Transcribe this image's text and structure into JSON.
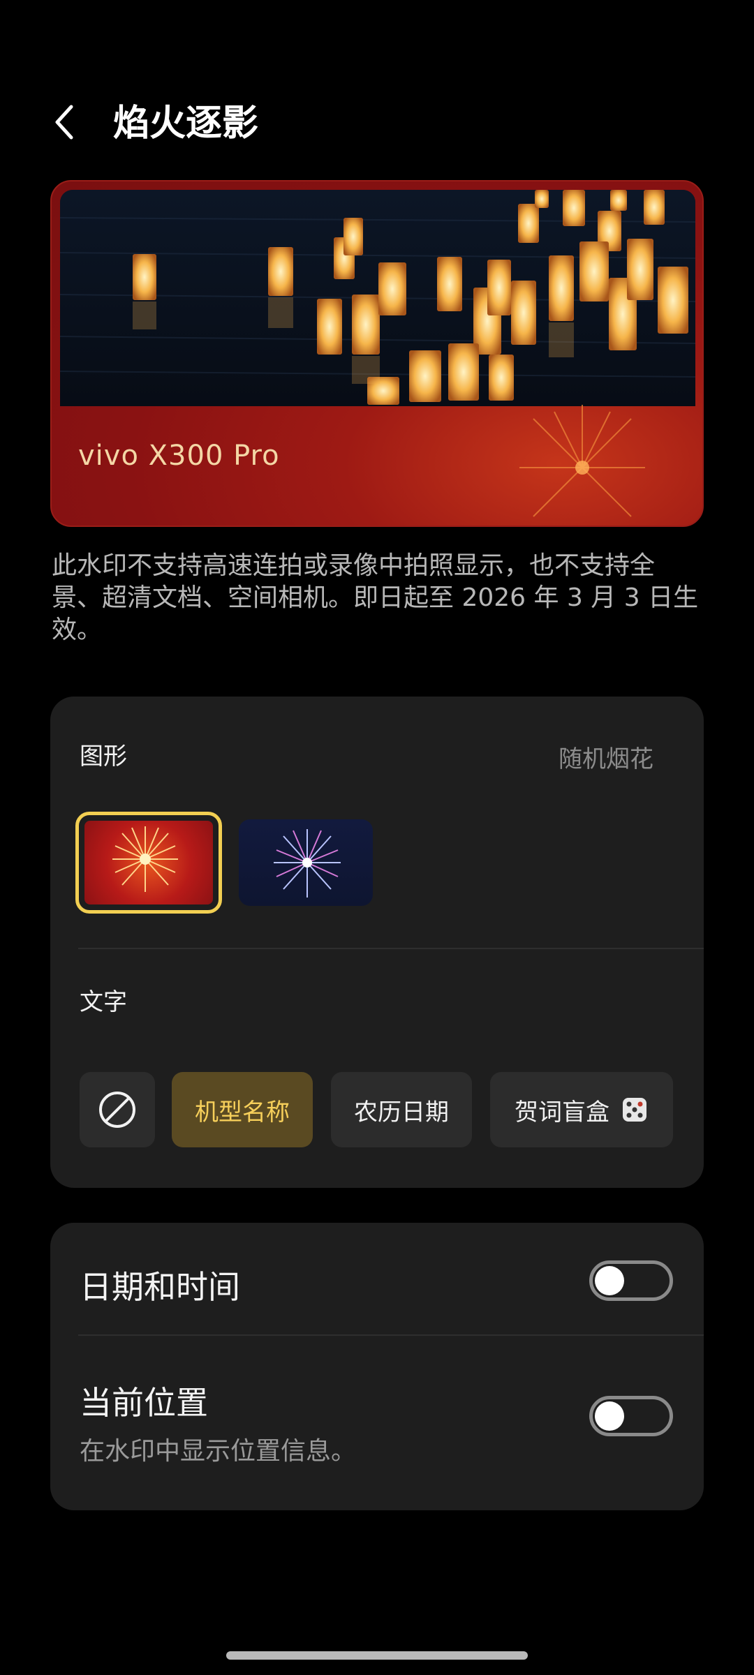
{
  "header": {
    "title": "焰火逐影",
    "back_icon": "chevron-left-icon"
  },
  "banner": {
    "brand_text": "vivo X300 Pro",
    "accent_color": "#9e1a14"
  },
  "notice": {
    "text": "此水印不支持高速连拍或录像中拍照显示，也不支持全景、超清文档、空间相机。即日起至 2026 年 3 月 3 日生效。"
  },
  "graphics_section": {
    "label": "图形",
    "random_label": "随机烟花",
    "options": [
      {
        "name": "red-firework",
        "selected": true
      },
      {
        "name": "blue-firework",
        "selected": false
      }
    ],
    "selection_color": "#f2cf52"
  },
  "text_section": {
    "label": "文字",
    "chips": [
      {
        "label": "",
        "icon": "prohibited-icon",
        "selected": false
      },
      {
        "label": "机型名称",
        "selected": true
      },
      {
        "label": "农历日期",
        "selected": false
      },
      {
        "label": "贺词盲盒",
        "icon": "dice-icon",
        "selected": false
      }
    ]
  },
  "settings": {
    "datetime": {
      "title": "日期和时间",
      "enabled": false
    },
    "location": {
      "title": "当前位置",
      "subtitle": "在水印中显示位置信息。",
      "enabled": false
    }
  }
}
